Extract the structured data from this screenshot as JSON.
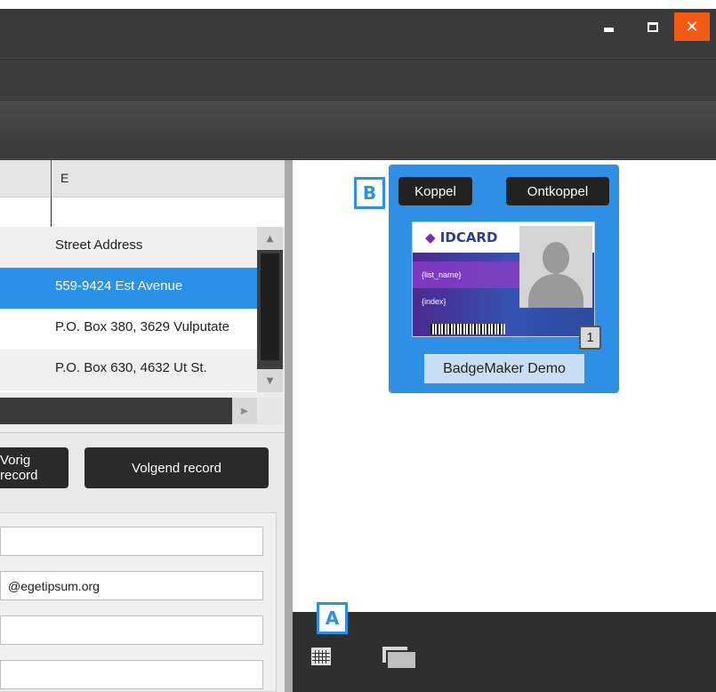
{
  "window": {
    "minimize_label": "minimize",
    "maximize_label": "maximize",
    "close_symbol": "✕"
  },
  "grid": {
    "column_header": "E",
    "rows": [
      {
        "value": "Street Address",
        "state": "alt"
      },
      {
        "value": "559-9424 Est Avenue",
        "state": "selected"
      },
      {
        "value": "P.O. Box 380, 3629 Vulputate",
        "state": "normal"
      },
      {
        "value": "P.O. Box 630, 4632 Ut St.",
        "state": "alt"
      }
    ]
  },
  "navigation": {
    "prev_label": "Vorig record",
    "next_label": "Volgend record"
  },
  "form": {
    "fields": [
      "",
      "@egetipsum.org",
      "",
      ""
    ]
  },
  "card_tile": {
    "koppel_label": "Koppel",
    "ontkoppel_label": "Ontkoppel",
    "card_logo": "IDCARD",
    "card_logo_mark": "◆",
    "card_fields": [
      "{list_name}",
      "{index}"
    ],
    "count": "1",
    "name": "BadgeMaker Demo"
  },
  "callouts": {
    "a": "A",
    "b": "B"
  },
  "icons": {
    "view_grid": "grid-view-icon",
    "view_stack": "stack-view-icon"
  },
  "colors": {
    "accent": "#2d8fe6",
    "close": "#f45a12",
    "selection": "#2b90e8"
  }
}
